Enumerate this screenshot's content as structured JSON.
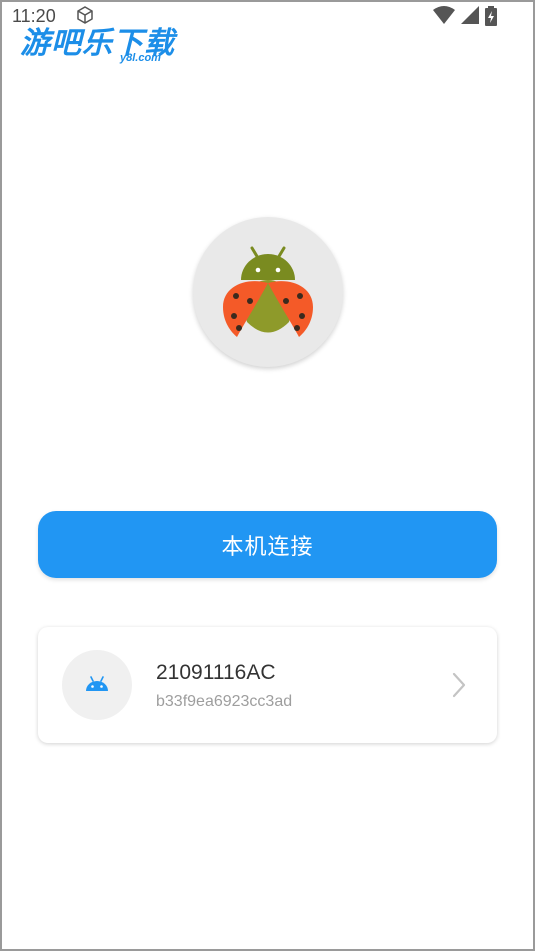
{
  "status_bar": {
    "time": "11:20",
    "icons": [
      "box-icon",
      "wifi-icon",
      "signal-icon",
      "battery-icon"
    ]
  },
  "watermark": {
    "main": "游吧乐下载",
    "sub": "y8l.com"
  },
  "app": {
    "logo_icon": "ladybug-android-icon"
  },
  "connect_button": {
    "label": "本机连接"
  },
  "device": {
    "name": "21091116AC",
    "serial": "b33f9ea6923cc3ad",
    "icon": "android-icon"
  },
  "colors": {
    "accent": "#2196f3",
    "android_green": "#7a8b20",
    "ladybug_red": "#f45a28",
    "watermark_blue": "#1c8ee8"
  }
}
